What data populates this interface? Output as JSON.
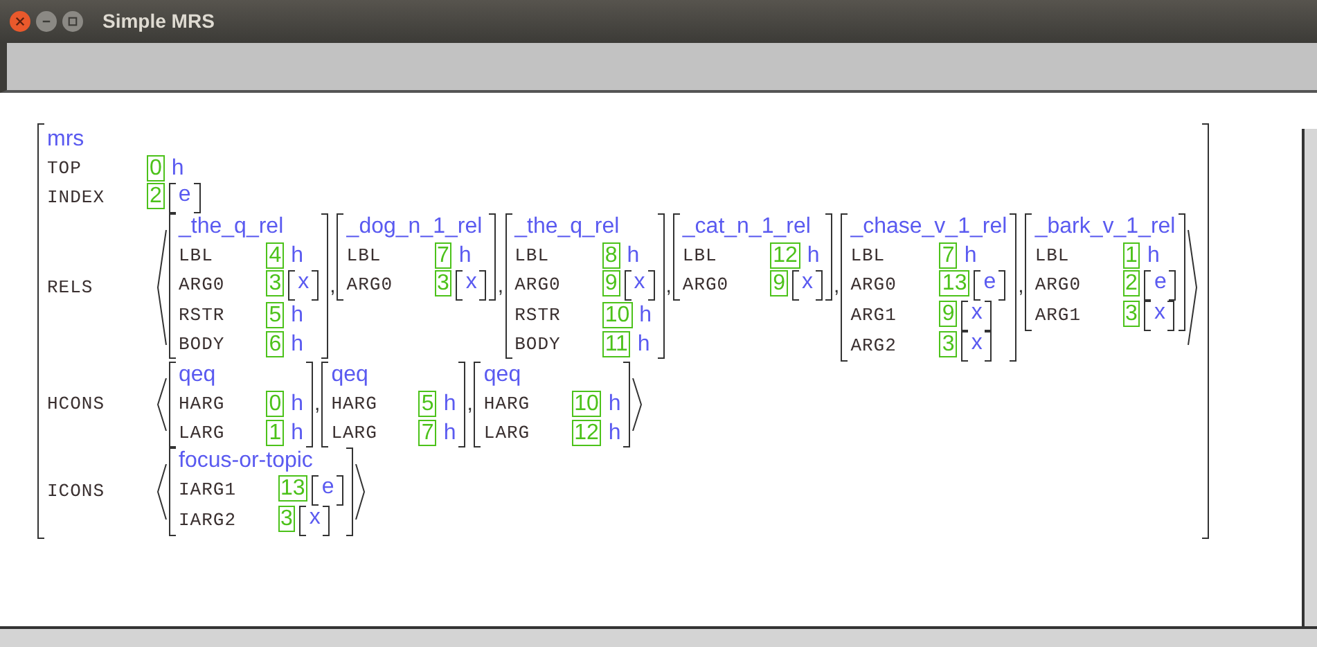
{
  "window": {
    "title": "Simple MRS"
  },
  "mrs": {
    "kind": "avm",
    "type": "mrs",
    "features": [
      {
        "name": "TOP",
        "value": {
          "kind": "atom",
          "tag": "0",
          "type": "h"
        }
      },
      {
        "name": "INDEX",
        "value": {
          "kind": "avm",
          "tag": "2",
          "type": "e"
        }
      },
      {
        "name": "RELS",
        "value": {
          "kind": "list",
          "separator": ",",
          "items": [
            {
              "kind": "avm",
              "type": "_the_q_rel",
              "features": [
                {
                  "name": "LBL",
                  "value": {
                    "kind": "atom",
                    "tag": "4",
                    "type": "h"
                  }
                },
                {
                  "name": "ARG0",
                  "value": {
                    "kind": "avm",
                    "tag": "3",
                    "type": "x"
                  }
                },
                {
                  "name": "RSTR",
                  "value": {
                    "kind": "atom",
                    "tag": "5",
                    "type": "h"
                  }
                },
                {
                  "name": "BODY",
                  "value": {
                    "kind": "atom",
                    "tag": "6",
                    "type": "h"
                  }
                }
              ]
            },
            {
              "kind": "avm",
              "type": "_dog_n_1_rel",
              "features": [
                {
                  "name": "LBL",
                  "value": {
                    "kind": "atom",
                    "tag": "7",
                    "type": "h"
                  }
                },
                {
                  "name": "ARG0",
                  "value": {
                    "kind": "avm",
                    "tag": "3",
                    "type": "x"
                  }
                }
              ]
            },
            {
              "kind": "avm",
              "type": "_the_q_rel",
              "features": [
                {
                  "name": "LBL",
                  "value": {
                    "kind": "atom",
                    "tag": "8",
                    "type": "h"
                  }
                },
                {
                  "name": "ARG0",
                  "value": {
                    "kind": "avm",
                    "tag": "9",
                    "type": "x"
                  }
                },
                {
                  "name": "RSTR",
                  "value": {
                    "kind": "atom",
                    "tag": "10",
                    "type": "h"
                  }
                },
                {
                  "name": "BODY",
                  "value": {
                    "kind": "atom",
                    "tag": "11",
                    "type": "h"
                  }
                }
              ]
            },
            {
              "kind": "avm",
              "type": "_cat_n_1_rel",
              "features": [
                {
                  "name": "LBL",
                  "value": {
                    "kind": "atom",
                    "tag": "12",
                    "type": "h"
                  }
                },
                {
                  "name": "ARG0",
                  "value": {
                    "kind": "avm",
                    "tag": "9",
                    "type": "x"
                  }
                }
              ]
            },
            {
              "kind": "avm",
              "type": "_chase_v_1_rel",
              "features": [
                {
                  "name": "LBL",
                  "value": {
                    "kind": "atom",
                    "tag": "7",
                    "type": "h"
                  }
                },
                {
                  "name": "ARG0",
                  "value": {
                    "kind": "avm",
                    "tag": "13",
                    "type": "e"
                  }
                },
                {
                  "name": "ARG1",
                  "value": {
                    "kind": "avm",
                    "tag": "9",
                    "type": "x"
                  }
                },
                {
                  "name": "ARG2",
                  "value": {
                    "kind": "avm",
                    "tag": "3",
                    "type": "x"
                  }
                }
              ]
            },
            {
              "kind": "avm",
              "type": "_bark_v_1_rel",
              "features": [
                {
                  "name": "LBL",
                  "value": {
                    "kind": "atom",
                    "tag": "1",
                    "type": "h"
                  }
                },
                {
                  "name": "ARG0",
                  "value": {
                    "kind": "avm",
                    "tag": "2",
                    "type": "e"
                  }
                },
                {
                  "name": "ARG1",
                  "value": {
                    "kind": "avm",
                    "tag": "3",
                    "type": "x"
                  }
                }
              ]
            }
          ]
        }
      },
      {
        "name": "HCONS",
        "value": {
          "kind": "list",
          "separator": ",",
          "items": [
            {
              "kind": "avm",
              "type": "qeq",
              "features": [
                {
                  "name": "HARG",
                  "value": {
                    "kind": "atom",
                    "tag": "0",
                    "type": "h"
                  }
                },
                {
                  "name": "LARG",
                  "value": {
                    "kind": "atom",
                    "tag": "1",
                    "type": "h"
                  }
                }
              ]
            },
            {
              "kind": "avm",
              "type": "qeq",
              "features": [
                {
                  "name": "HARG",
                  "value": {
                    "kind": "atom",
                    "tag": "5",
                    "type": "h"
                  }
                },
                {
                  "name": "LARG",
                  "value": {
                    "kind": "atom",
                    "tag": "7",
                    "type": "h"
                  }
                }
              ]
            },
            {
              "kind": "avm",
              "type": "qeq",
              "features": [
                {
                  "name": "HARG",
                  "value": {
                    "kind": "atom",
                    "tag": "10",
                    "type": "h"
                  }
                },
                {
                  "name": "LARG",
                  "value": {
                    "kind": "atom",
                    "tag": "12",
                    "type": "h"
                  }
                }
              ]
            }
          ]
        }
      },
      {
        "name": "ICONS",
        "value": {
          "kind": "list",
          "items": [
            {
              "kind": "avm",
              "type": "focus-or-topic",
              "features": [
                {
                  "name": "IARG1",
                  "value": {
                    "kind": "avm",
                    "tag": "13",
                    "type": "e"
                  }
                },
                {
                  "name": "IARG2",
                  "value": {
                    "kind": "avm",
                    "tag": "3",
                    "type": "x"
                  }
                }
              ]
            }
          ]
        }
      }
    ]
  }
}
